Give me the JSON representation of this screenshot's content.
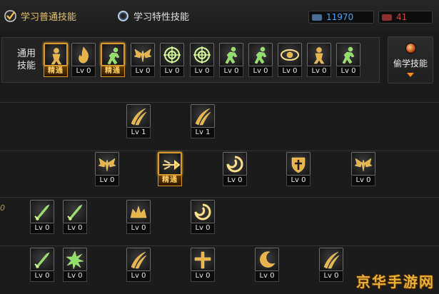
{
  "tabs": [
    {
      "label": "学习普通技能",
      "selected": true
    },
    {
      "label": "学习特性技能",
      "selected": false
    }
  ],
  "currencies": [
    {
      "value": "11970",
      "color": "#4aa6ff"
    },
    {
      "value": "41",
      "color": "#d04848"
    }
  ],
  "common_panel": {
    "label_line1": "通用",
    "label_line2": "技能"
  },
  "steal_button": {
    "label": "偷学技能"
  },
  "side_mark": "0",
  "watermark": "京华手游网",
  "common_skills": [
    {
      "name": "skill-common-1",
      "lv": "精通",
      "master": true,
      "glyph": "figure",
      "color": "gold"
    },
    {
      "name": "skill-common-2",
      "lv": "Lv 0",
      "master": false,
      "glyph": "flame",
      "color": "gold"
    },
    {
      "name": "skill-common-3",
      "lv": "精通",
      "master": true,
      "glyph": "run",
      "color": "green"
    },
    {
      "name": "skill-common-4",
      "lv": "Lv 0",
      "master": false,
      "glyph": "wings",
      "color": "gold"
    },
    {
      "name": "skill-common-5",
      "lv": "Lv 0",
      "master": false,
      "glyph": "target",
      "color": "green"
    },
    {
      "name": "skill-common-6",
      "lv": "Lv 0",
      "master": false,
      "glyph": "target",
      "color": "green"
    },
    {
      "name": "skill-common-7",
      "lv": "Lv 0",
      "master": false,
      "glyph": "run",
      "color": "green"
    },
    {
      "name": "skill-common-8",
      "lv": "Lv 0",
      "master": false,
      "glyph": "run",
      "color": "green"
    },
    {
      "name": "skill-common-9",
      "lv": "Lv 0",
      "master": false,
      "glyph": "eye",
      "color": "gold"
    },
    {
      "name": "skill-common-10",
      "lv": "Lv 0",
      "master": false,
      "glyph": "figure",
      "color": "gold"
    },
    {
      "name": "skill-common-11",
      "lv": "Lv 0",
      "master": false,
      "glyph": "run",
      "color": "green"
    }
  ],
  "tree_skills": [
    {
      "name": "skill-tree-r1-1",
      "lv": "Lv 1",
      "master": false,
      "glyph": "slash",
      "color": "gold"
    },
    {
      "name": "skill-tree-r1-2",
      "lv": "Lv 1",
      "master": false,
      "glyph": "slash",
      "color": "gold"
    },
    {
      "name": "skill-tree-r2-1",
      "lv": "Lv 0",
      "master": false,
      "glyph": "wings",
      "color": "gold"
    },
    {
      "name": "skill-tree-r2-2",
      "lv": "精通",
      "master": true,
      "glyph": "arrow",
      "color": "gold"
    },
    {
      "name": "skill-tree-r2-3",
      "lv": "Lv 0",
      "master": false,
      "glyph": "swirl",
      "color": "gold"
    },
    {
      "name": "skill-tree-r2-4",
      "lv": "Lv 0",
      "master": false,
      "glyph": "shield",
      "color": "gold"
    },
    {
      "name": "skill-tree-r2-5",
      "lv": "Lv 0",
      "master": false,
      "glyph": "wings",
      "color": "gold"
    },
    {
      "name": "skill-tree-r3-1",
      "lv": "Lv 0",
      "master": false,
      "glyph": "blade",
      "color": "green"
    },
    {
      "name": "skill-tree-r3-2",
      "lv": "Lv 0",
      "master": false,
      "glyph": "blade",
      "color": "green"
    },
    {
      "name": "skill-tree-r3-3",
      "lv": "Lv 0",
      "master": false,
      "glyph": "crown",
      "color": "gold"
    },
    {
      "name": "skill-tree-r3-4",
      "lv": "Lv 0",
      "master": false,
      "glyph": "swirl",
      "color": "gold"
    },
    {
      "name": "skill-tree-r4-1",
      "lv": "Lv 0",
      "master": false,
      "glyph": "blade",
      "color": "green"
    },
    {
      "name": "skill-tree-r4-2",
      "lv": "Lv 0",
      "master": false,
      "glyph": "burst",
      "color": "green"
    },
    {
      "name": "skill-tree-r4-3",
      "lv": "Lv 0",
      "master": false,
      "glyph": "slash",
      "color": "gold"
    },
    {
      "name": "skill-tree-r4-4",
      "lv": "Lv 0",
      "master": false,
      "glyph": "cross",
      "color": "gold"
    },
    {
      "name": "skill-tree-r4-5",
      "lv": "Lv 0",
      "master": false,
      "glyph": "moon",
      "color": "gold"
    },
    {
      "name": "skill-tree-r4-6",
      "lv": "Lv 0",
      "master": false,
      "glyph": "slash",
      "color": "gold"
    }
  ]
}
